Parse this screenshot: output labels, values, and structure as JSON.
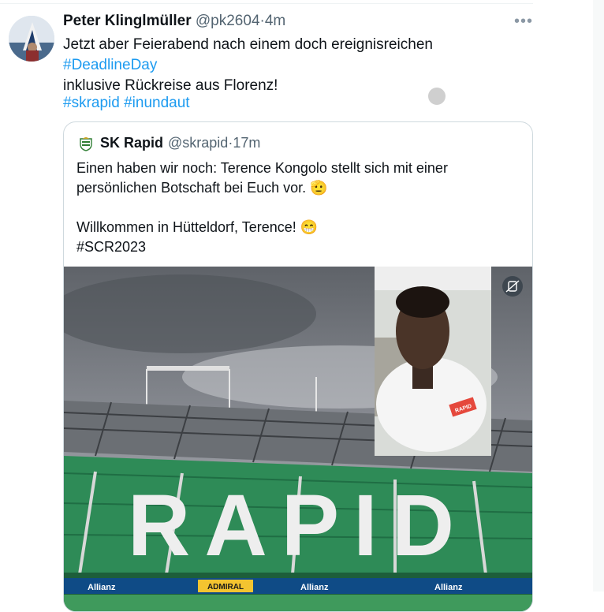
{
  "tweet": {
    "author_name": "Peter Klinglmüller",
    "handle": "@pk2604",
    "separator": "·",
    "time": "4m",
    "text_line1": "Jetzt aber Feierabend nach einem doch ereignisreichen ",
    "text_hashtag": "#DeadlineDay",
    "text_line2": "inklusive Rückreise aus Florenz!",
    "hashtags": [
      "#skrapid",
      "#inundaut"
    ],
    "more_icon": "more-horizontal-icon"
  },
  "quote": {
    "author_name": "SK Rapid",
    "handle": "@skrapid",
    "separator": "·",
    "time": "17m",
    "line1": "Einen haben wir noch: Terence Kongolo stellt sich mit einer",
    "line2": "persönlichen Botschaft bei Euch vor. 🫡",
    "line3": "Willkommen in Hütteldorf, Terence! 😁",
    "line4": "#SCR2023",
    "media": {
      "stand_letters": "RAPID",
      "board_labels": [
        "Allianz",
        "ADMIRAL",
        "Allianz",
        "Allianz"
      ],
      "shirt_text": "RAPID",
      "badge_icon": "gif-badge-icon"
    }
  },
  "colors": {
    "link": "#1d9bf0",
    "muted": "#536471",
    "seat_green": "#2e8b57",
    "sky": "#7d8188"
  }
}
